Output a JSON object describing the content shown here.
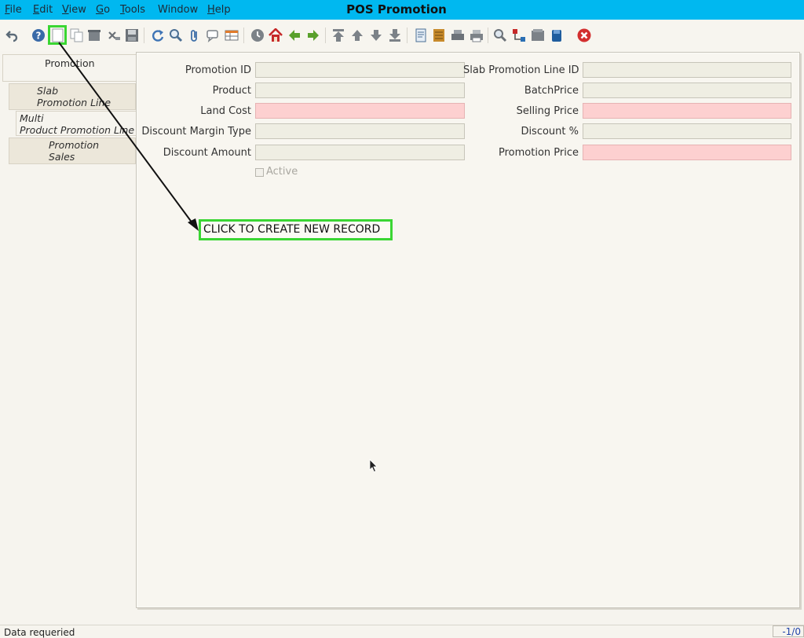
{
  "window": {
    "title": "POS Promotion"
  },
  "menu": {
    "items": [
      {
        "label": "File"
      },
      {
        "label": "Edit"
      },
      {
        "label": "View"
      },
      {
        "label": "Go"
      },
      {
        "label": "Tools"
      },
      {
        "label": "Window"
      },
      {
        "label": "Help"
      }
    ]
  },
  "toolbar": {
    "icons": [
      "undo-icon",
      "help-icon",
      "new-record-icon",
      "copy-record-icon",
      "delete-icon",
      "delete-selection-icon",
      "save-icon",
      "refresh-icon",
      "find-icon",
      "attachment-icon",
      "chat-icon",
      "grid-toggle-icon",
      "history-icon",
      "home-icon",
      "parent-record-icon",
      "detail-record-icon",
      "first-record-icon",
      "previous-record-icon",
      "next-record-icon",
      "last-record-icon",
      "report-icon",
      "archive-icon",
      "print-preview-icon",
      "print-icon",
      "zoom-across-icon",
      "workflow-icon",
      "product-info-icon",
      "lock-icon",
      "exit-icon"
    ]
  },
  "tabs": [
    {
      "line1": "Promotion",
      "line2": ""
    },
    {
      "line1": "Slab",
      "line2": "Promotion Line"
    },
    {
      "line1": "Multi",
      "line2": "Product Promotion Line"
    },
    {
      "line1": "Promotion",
      "line2": "Sales"
    }
  ],
  "form": {
    "promotion_id": {
      "label": "Promotion ID",
      "value": ""
    },
    "slab_promotion_line_id": {
      "label": "Slab Promotion Line ID",
      "value": ""
    },
    "product": {
      "label": "Product",
      "value": ""
    },
    "batch_price": {
      "label": "BatchPrice",
      "value": ""
    },
    "land_cost": {
      "label": "Land Cost",
      "value": "",
      "required": true
    },
    "selling_price": {
      "label": "Selling Price",
      "value": "",
      "required": true
    },
    "discount_margin_type": {
      "label": "Discount Margin Type",
      "value": ""
    },
    "discount_pct": {
      "label": "Discount %",
      "value": ""
    },
    "discount_amount": {
      "label": "Discount Amount",
      "value": ""
    },
    "promotion_price": {
      "label": "Promotion Price",
      "value": "",
      "required": true
    },
    "active": {
      "label": "Active",
      "checked": false
    }
  },
  "annotation": {
    "text": "CLICK TO CREATE NEW RECORD"
  },
  "status": {
    "message": "Data requeried",
    "record_count": "-1/0"
  },
  "colors": {
    "title_bar": "#00b8f0",
    "required_field": "#fdd0d0",
    "highlight": "#3ad633"
  }
}
